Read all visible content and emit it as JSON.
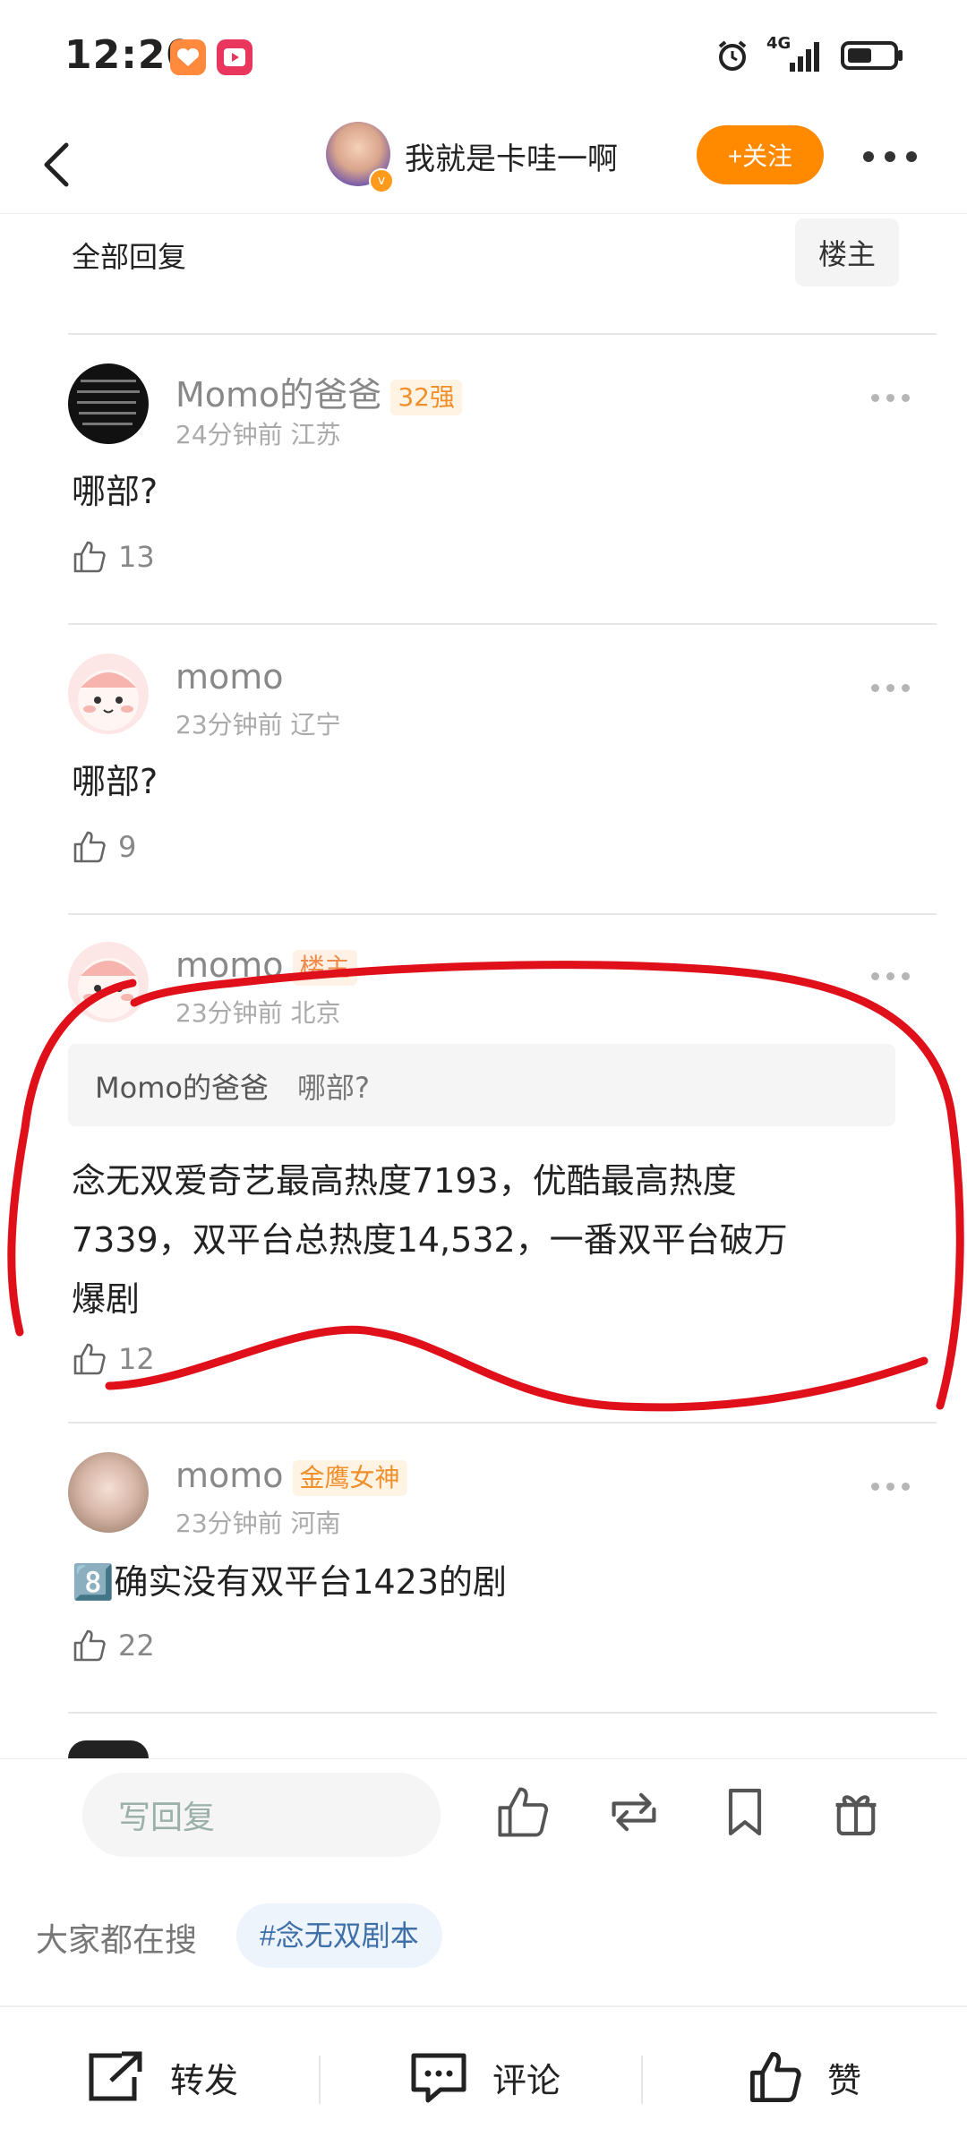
{
  "status_bar": {
    "time": "12:20",
    "network": "4G"
  },
  "header": {
    "username": "我就是卡哇一啊",
    "follow_label": "+关注"
  },
  "filter": {
    "all_replies": "全部回复",
    "owner_only": "楼主"
  },
  "comments": [
    {
      "name": "Momo的爸爸",
      "badge": "32强",
      "time": "24分钟前",
      "region": "江苏",
      "text": "哪部?",
      "likes": "13"
    },
    {
      "name": "momo",
      "badge": "",
      "time": "23分钟前",
      "region": "辽宁",
      "text": "哪部?",
      "likes": "9"
    },
    {
      "name": "momo",
      "badge": "楼主",
      "time": "23分钟前",
      "region": "北京",
      "quote_user": "Momo的爸爸",
      "quote_text": "哪部?",
      "text_lines": [
        "念无双爱奇艺最高热度7193，优酷最高热度",
        "7339，双平台总热度14,532，一番双平台破万",
        "爆剧"
      ],
      "likes": "12"
    },
    {
      "name": "momo",
      "badge": "金鹰女神",
      "time": "23分钟前",
      "region": "河南",
      "text": "8️⃣确实没有双平台1423的剧",
      "likes": "22"
    }
  ],
  "reply_bar": {
    "placeholder": "写回复"
  },
  "search": {
    "label": "大家都在搜",
    "tag": "#念无双剧本"
  },
  "actions": {
    "share": "转发",
    "comment": "评论",
    "like": "赞"
  },
  "colors": {
    "accent_orange": "#ff8a00",
    "annotation_red": "#e0101a",
    "tag_blue": "#3f6fa8"
  }
}
